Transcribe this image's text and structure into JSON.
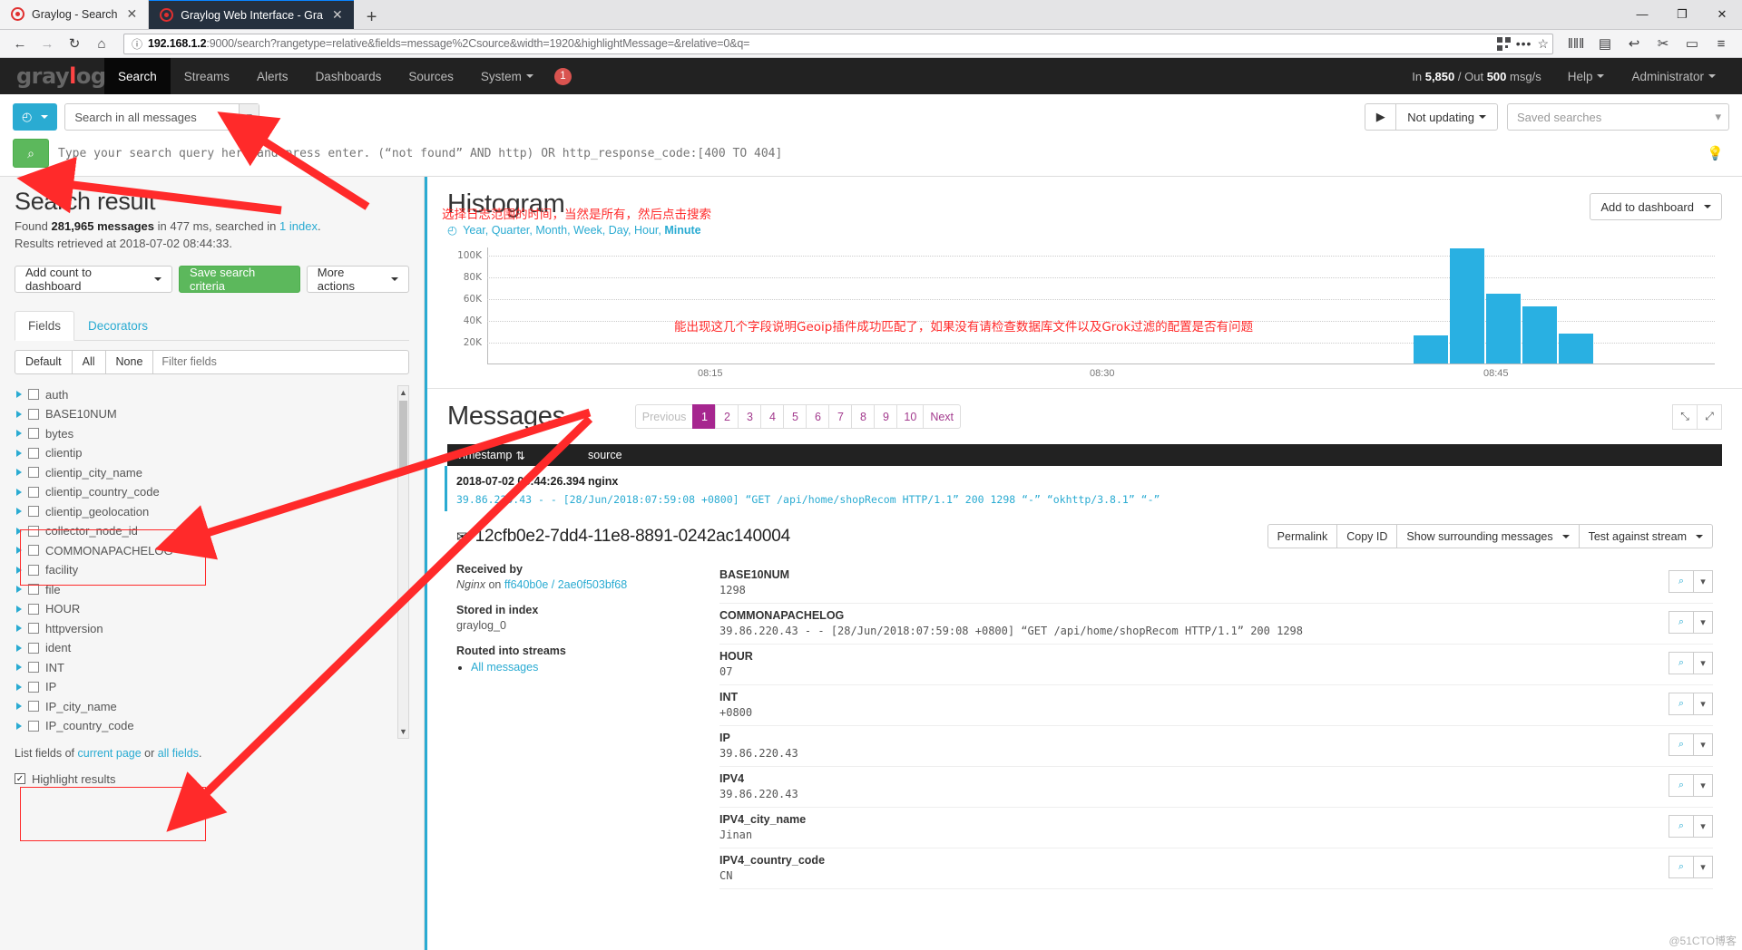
{
  "browser": {
    "tabs": [
      {
        "title": "Graylog - Search",
        "active": false
      },
      {
        "title": "Graylog Web Interface - Gra",
        "active": true
      }
    ],
    "newtab_label": "+",
    "window_buttons": [
      "—",
      "❐",
      "✕"
    ],
    "nav": {
      "back": "←",
      "forward": "→",
      "reload": "↻",
      "home": "⌂",
      "info_icon": "ⓘ",
      "url_host": "192.168.1.2",
      "url_rest": ":9000/search?rangetype=relative&fields=message%2Csource&width=1920&highlightMessage=&relative=0&q=",
      "dots": "•••",
      "star": "☆",
      "library": "‖‖‖",
      "sidebar": "▤",
      "undo": "↩",
      "screenshot": "✂",
      "chat": "▭",
      "menu": "≡"
    }
  },
  "gl_nav": {
    "logo": "graylog",
    "items": [
      {
        "label": "Search",
        "active": true
      },
      {
        "label": "Streams",
        "active": false
      },
      {
        "label": "Alerts",
        "active": false
      },
      {
        "label": "Dashboards",
        "active": false
      },
      {
        "label": "Sources",
        "active": false
      },
      {
        "label": "System",
        "active": false,
        "caret": true
      }
    ],
    "badge": "1",
    "throughput": "In 5,850 / Out 500 msg/s",
    "throughput_in_label": "In",
    "throughput_in": "5,850",
    "throughput_out_label": "/ Out",
    "throughput_out": "500",
    "throughput_unit": "msg/s",
    "help": "Help",
    "user": "Administrator"
  },
  "searchbar": {
    "timerange_icon": "◴",
    "timerange_value": "Search in all messages",
    "query_placeholder": "Type your search query here and press enter. (“not found” AND http) OR http_response_code:[400 TO 404]",
    "search_icon": "⌕",
    "play_icon": "▶",
    "not_updating": "Not updating",
    "saved_searches_placeholder": "Saved searches",
    "bulb_icon": "Ὂ1"
  },
  "sidebar": {
    "title": "Search result",
    "found_prefix": "Found",
    "found_count": "281,965 messages",
    "found_mid": "in 477 ms, searched in",
    "found_index": "1 index",
    "found_suffix": ".",
    "retrieved": "Results retrieved at 2018-07-02 08:44:33.",
    "buttons": [
      {
        "label": "Add count to dashboard",
        "caret": true,
        "green": false
      },
      {
        "label": "Save search criteria",
        "caret": false,
        "green": true
      },
      {
        "label": "More actions",
        "caret": true,
        "green": false
      }
    ],
    "tabs": [
      {
        "label": "Fields",
        "active": true
      },
      {
        "label": "Decorators",
        "active": false
      }
    ],
    "segments": [
      "Default",
      "All",
      "None"
    ],
    "filter_placeholder": "Filter fields",
    "fields": [
      "auth",
      "BASE10NUM",
      "bytes",
      "clientip",
      "clientip_city_name",
      "clientip_country_code",
      "clientip_geolocation",
      "collector_node_id",
      "COMMONAPACHELOG",
      "facility",
      "file",
      "HOUR",
      "httpversion",
      "ident",
      "INT",
      "IP",
      "IP_city_name",
      "IP_country_code"
    ],
    "note_prefix": "List fields of",
    "note_link1": "current page",
    "note_mid": "or",
    "note_link2": "all fields",
    "note_suffix": ".",
    "highlight_label": "Highlight results",
    "highlight_checked": true
  },
  "histogram": {
    "title": "Histogram",
    "clock_icon": "◴",
    "resolutions": [
      "Year",
      "Quarter",
      "Month",
      "Week",
      "Day",
      "Hour",
      "Minute"
    ],
    "active_resolution": "Minute",
    "add_to_dashboard": "Add to dashboard"
  },
  "chart_data": {
    "type": "bar",
    "title": "Histogram",
    "xlabel": "",
    "ylabel": "",
    "ylim": [
      0,
      110000
    ],
    "ytick_labels": [
      "20K",
      "40K",
      "60K",
      "80K",
      "100K"
    ],
    "ytick_values": [
      20000,
      40000,
      60000,
      80000,
      100000
    ],
    "xtick_labels": [
      "08:15",
      "08:30",
      "08:45"
    ],
    "grid": true,
    "legend": "none",
    "bar_color": "#29b0e2",
    "categories": [
      "08:40",
      "08:41",
      "08:42",
      "08:43",
      "08:44"
    ],
    "values": [
      26000,
      107000,
      65000,
      53000,
      28000
    ]
  },
  "messages": {
    "title": "Messages",
    "pager": {
      "previous": "Previous",
      "pages": [
        "1",
        "2",
        "3",
        "4",
        "5",
        "6",
        "7",
        "8",
        "9",
        "10"
      ],
      "active_page": "1",
      "next": "Next"
    },
    "expand_icon": "⤡",
    "collapse_icon": "⤢",
    "columns": [
      "Timestamp",
      "source"
    ],
    "sort_icon": "⇅",
    "row": {
      "timestamp": "2018-07-02 08:44:26.394",
      "source": "nginx",
      "message": "39.86.220.43 - - [28/Jun/2018:07:59:08 +0800] “GET /api/home/shopRecom HTTP/1.1” 200 1298 “-” “okhttp/3.8.1” “-”"
    },
    "detail_id": "12cfb0e2-7dd4-11e8-8891-0242ac140004",
    "envelope_icon": "✉",
    "actions": [
      {
        "label": "Permalink",
        "caret": false
      },
      {
        "label": "Copy ID",
        "caret": false
      },
      {
        "label": "Show surrounding messages",
        "caret": true
      },
      {
        "label": "Test against stream",
        "caret": true
      }
    ],
    "left_detail": [
      {
        "key": "Received by",
        "value_em": "Nginx",
        "value_mid": "on",
        "value_link": "ff640b0e / 2ae0f503bf68"
      },
      {
        "key": "Stored in index",
        "value": "graylog_0"
      },
      {
        "key": "Routed into streams",
        "list": [
          "All messages"
        ]
      }
    ],
    "fields": [
      {
        "key": "BASE10NUM",
        "value": "1298"
      },
      {
        "key": "COMMONAPACHELOG",
        "value": "39.86.220.43 - - [28/Jun/2018:07:59:08 +0800] “GET /api/home/shopRecom HTTP/1.1” 200 1298"
      },
      {
        "key": "HOUR",
        "value": "07"
      },
      {
        "key": "INT",
        "value": "+0800"
      },
      {
        "key": "IP",
        "value": "39.86.220.43"
      },
      {
        "key": "IPV4",
        "value": "39.86.220.43"
      },
      {
        "key": "IPV4_city_name",
        "value": "Jinan"
      },
      {
        "key": "IPV4_country_code",
        "value": "CN"
      }
    ],
    "zoom_in_icon": "⌕",
    "zoom_caret": "▾"
  },
  "annotations": {
    "timerange_note": "选择日志范围的时间，当然是所有，然后点击搜索",
    "geoip_note": "能出现这几个字段说明Geoip插件成功匹配了，如果没有请检查数据库文件以及Grok过滤的配置是否有问题",
    "watermark": "@51CTO博客"
  }
}
